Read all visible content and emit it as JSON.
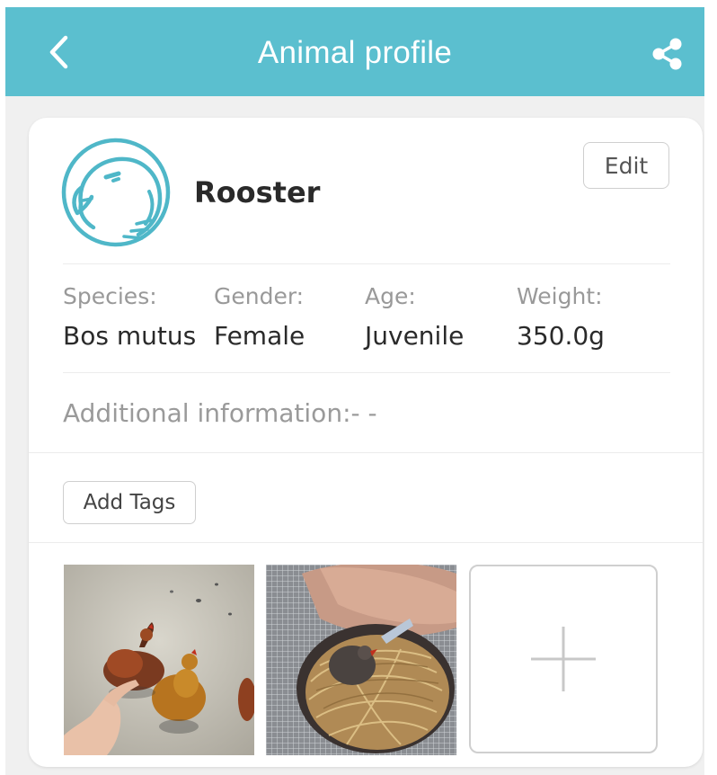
{
  "header": {
    "title": "Animal profile",
    "back_icon": "chevron-left-icon",
    "share_icon": "share-icon",
    "background_color": "#5bbfcf"
  },
  "profile": {
    "avatar_icon": "bird-icon",
    "name": "Rooster",
    "edit_label": "Edit"
  },
  "fields": [
    {
      "label": "Species:",
      "value": "Bos mutus"
    },
    {
      "label": "Gender:",
      "value": "Female"
    },
    {
      "label": "Age:",
      "value": "Juvenile"
    },
    {
      "label": "Weight:",
      "value": "350.0g"
    }
  ],
  "additional_info": "Additional information:- -",
  "tags": {
    "add_label": "Add Tags"
  },
  "photos": {
    "items": [
      "chickens-photo",
      "nest-photo"
    ],
    "add_icon": "plus-icon"
  }
}
